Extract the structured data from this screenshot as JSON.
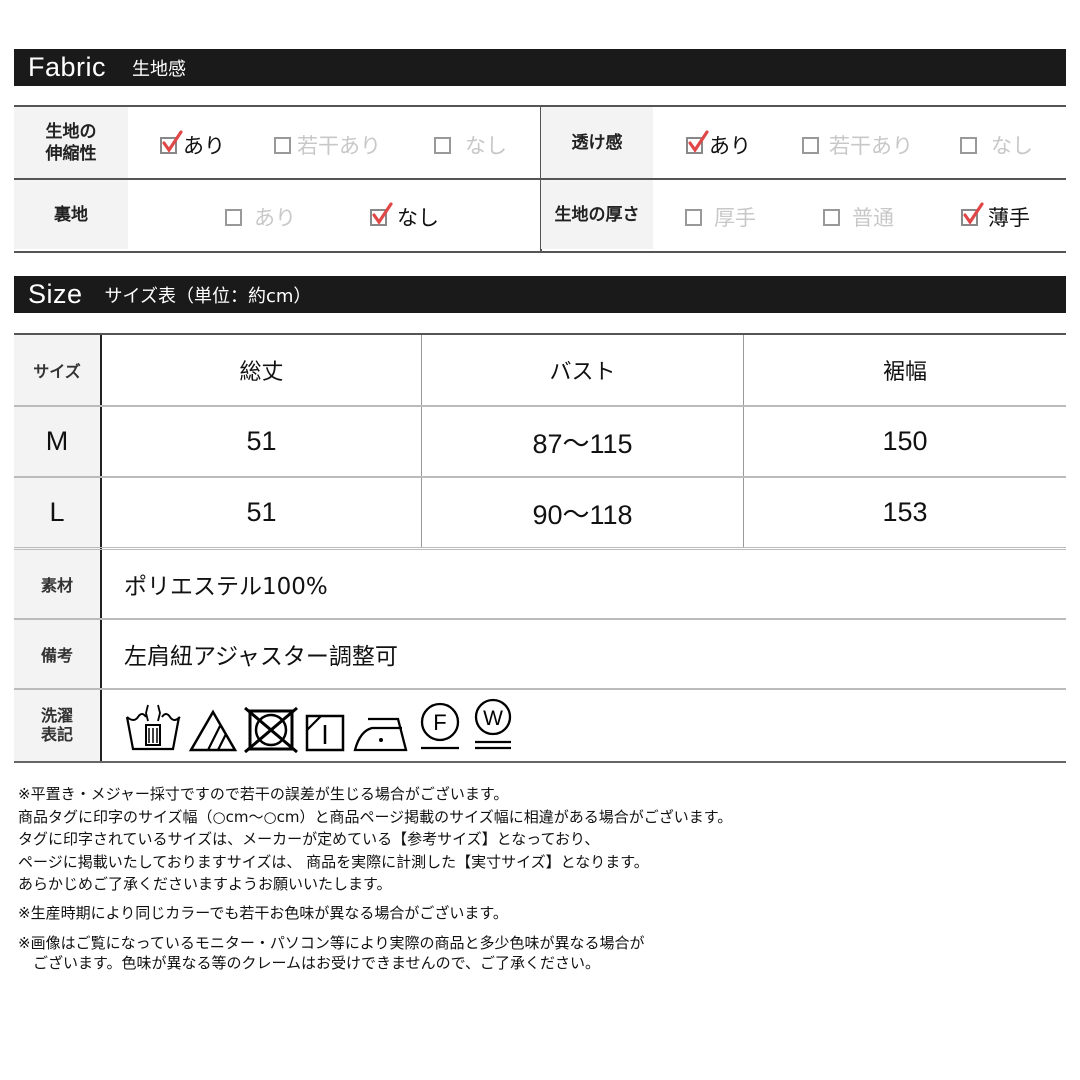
{
  "fabric_section": {
    "title_en": "Fabric",
    "title_jp": "生地感",
    "rows": [
      {
        "label": "生地の\n伸縮性",
        "options": [
          {
            "label": "あり",
            "checked": true
          },
          {
            "label": "若干あり",
            "checked": false
          },
          {
            "label": "なし",
            "checked": false
          }
        ]
      },
      {
        "label": "透け感",
        "options": [
          {
            "label": "あり",
            "checked": true
          },
          {
            "label": "若干あり",
            "checked": false
          },
          {
            "label": "なし",
            "checked": false
          }
        ]
      },
      {
        "label": "裏地",
        "options": [
          {
            "label": "あり",
            "checked": false
          },
          {
            "label": "なし",
            "checked": true
          }
        ]
      },
      {
        "label": "生地の厚さ",
        "options": [
          {
            "label": "厚手",
            "checked": false
          },
          {
            "label": "普通",
            "checked": false
          },
          {
            "label": "薄手",
            "checked": true
          }
        ]
      }
    ],
    "check_color": "#e04848"
  },
  "size_section": {
    "title_en": "Size",
    "title_jp": "サイズ表（単位：約cm）",
    "headers": [
      "サイズ",
      "総丈",
      "バスト",
      "裾幅"
    ],
    "rows": [
      [
        "M",
        "51",
        "87〜115",
        "150"
      ],
      [
        "L",
        "51",
        "90〜118",
        "153"
      ]
    ],
    "info_rows": [
      {
        "label": "素材",
        "value": "ポリエステル100%"
      },
      {
        "label": "備考",
        "value": "左肩紐アジャスター調整可"
      },
      {
        "label": "洗濯\n表記",
        "value": ""
      }
    ],
    "care_symbols": [
      "hand-wash-icon",
      "bleach-non-chlorine-icon",
      "do-not-tumble-dry-icon",
      "drip-dry-shade-icon",
      "iron-low-icon",
      "dry-clean-f-mild-icon",
      "wet-clean-w-very-mild-icon"
    ],
    "care_letters": {
      "dry_clean": "F",
      "wet_clean": "W"
    }
  },
  "notes": [
    "※平置き・メジャー採寸ですので若干の誤差が生じる場合がございます。",
    "商品タグに印字のサイズ幅（○cm〜○cm）と商品ページ掲載のサイズ幅に相違がある場合がございます。",
    "タグに印字されているサイズは、メーカーが定めている【参考サイズ】となっており、",
    "ページに掲載いたしておりますサイズは、 商品を実際に計測した【実寸サイズ】となります。",
    "あらかじめご了承くださいますようお願いいたします。",
    "※生産時期により同じカラーでも若干お色味が異なる場合がございます。",
    "※画像はご覧になっているモニター・パソコン等により実際の商品と多少色味が異なる場合が",
    "　ございます。色味が異なる等のクレームはお受けできませんので、ご了承ください。"
  ]
}
